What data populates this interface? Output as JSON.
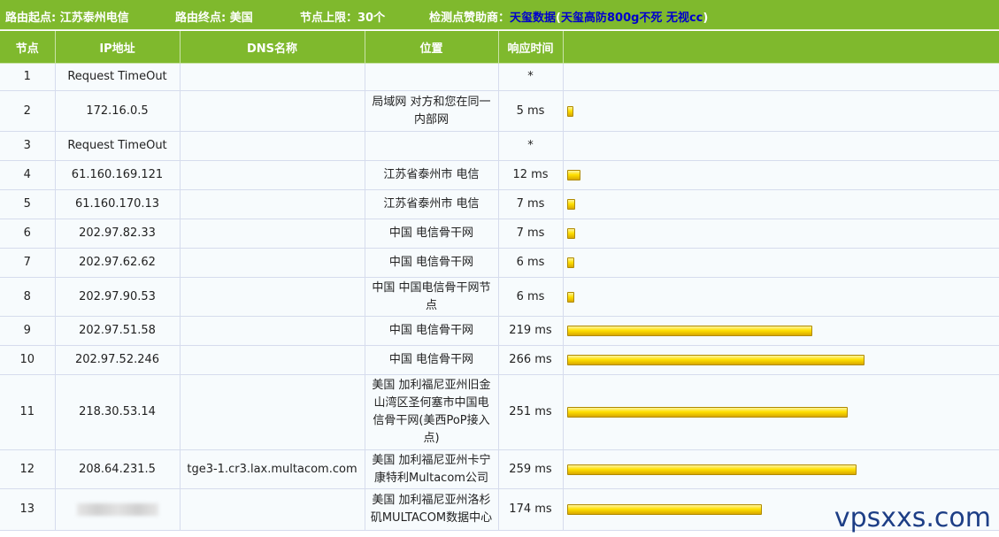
{
  "header": {
    "origin": "路由起点: 江苏泰州电信",
    "destination": "路由终点: 美国",
    "hop_limit": "节点上限：30个",
    "sponsor_label": "检测点赞助商：",
    "sponsor_name": "天玺数据",
    "sponsor_paren_open": "(",
    "sponsor_link": "天玺高防800g不死 无视cc",
    "sponsor_paren_close": ")"
  },
  "columns": {
    "hop": "节点",
    "ip": "IP地址",
    "dns": "DNS名称",
    "location": "位置",
    "latency": "响应时间",
    "bar": ""
  },
  "rows": [
    {
      "hop": "1",
      "ip": "Request TimeOut",
      "dns": "",
      "location": "",
      "latency": "*",
      "ms": 0
    },
    {
      "hop": "2",
      "ip": "172.16.0.5",
      "dns": "",
      "location": "局域网 对方和您在同一内部网",
      "latency": "5 ms",
      "ms": 5
    },
    {
      "hop": "3",
      "ip": "Request TimeOut",
      "dns": "",
      "location": "",
      "latency": "*",
      "ms": 0
    },
    {
      "hop": "4",
      "ip": "61.160.169.121",
      "dns": "",
      "location": "江苏省泰州市 电信",
      "latency": "12 ms",
      "ms": 12
    },
    {
      "hop": "5",
      "ip": "61.160.170.13",
      "dns": "",
      "location": "江苏省泰州市 电信",
      "latency": "7 ms",
      "ms": 7
    },
    {
      "hop": "6",
      "ip": "202.97.82.33",
      "dns": "",
      "location": "中国 电信骨干网",
      "latency": "7 ms",
      "ms": 7
    },
    {
      "hop": "7",
      "ip": "202.97.62.62",
      "dns": "",
      "location": "中国 电信骨干网",
      "latency": "6 ms",
      "ms": 6
    },
    {
      "hop": "8",
      "ip": "202.97.90.53",
      "dns": "",
      "location": "中国 中国电信骨干网节点",
      "latency": "6 ms",
      "ms": 6
    },
    {
      "hop": "9",
      "ip": "202.97.51.58",
      "dns": "",
      "location": "中国 电信骨干网",
      "latency": "219 ms",
      "ms": 219
    },
    {
      "hop": "10",
      "ip": "202.97.52.246",
      "dns": "",
      "location": "中国 电信骨干网",
      "latency": "266 ms",
      "ms": 266
    },
    {
      "hop": "11",
      "ip": "218.30.53.14",
      "dns": "",
      "location": "美国 加利福尼亚州旧金山湾区圣何塞市中国电信骨干网(美西PoP接入点)",
      "latency": "251 ms",
      "ms": 251
    },
    {
      "hop": "12",
      "ip": "208.64.231.5",
      "dns": "tge3-1.cr3.lax.multacom.com",
      "location": "美国 加利福尼亚州卡宁康特利Multacom公司",
      "latency": "259 ms",
      "ms": 259
    },
    {
      "hop": "13",
      "ip": "",
      "ip_blurred": true,
      "dns": "",
      "location": "美国 加利福尼亚州洛杉矶MULTACOM数据中心",
      "latency": "174 ms",
      "ms": 174
    }
  ],
  "bar_color": "#ffe000",
  "header_color": "#7fb92d",
  "sponsor_link_color": "#0000cc",
  "watermark": "vpsxxs.com"
}
